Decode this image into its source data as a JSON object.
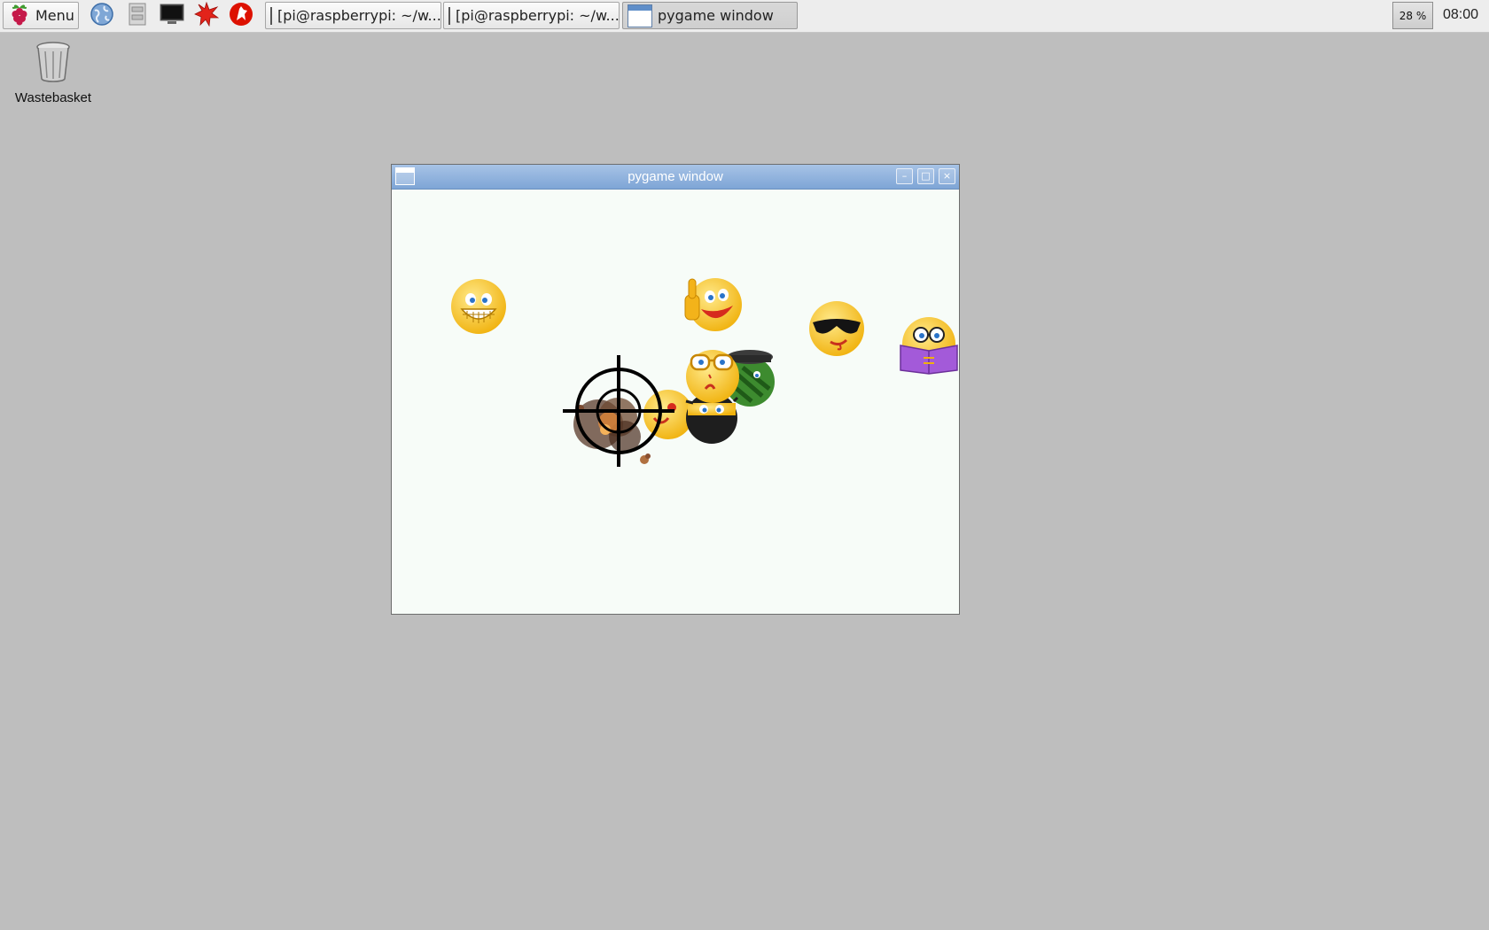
{
  "taskbar": {
    "menu_label": "Menu",
    "launchers": [
      "browser-icon",
      "file-manager-icon",
      "terminal-icon",
      "mathematica-icon",
      "wolfram-icon"
    ],
    "tasks": [
      {
        "label": "[pi@raspberrypi: ~/w...",
        "icon": "terminal-icon",
        "active": false
      },
      {
        "label": "[pi@raspberrypi: ~/w...",
        "icon": "terminal-icon",
        "active": false
      },
      {
        "label": "pygame window",
        "icon": "window-icon",
        "active": true
      }
    ],
    "cpu_usage": "28 %",
    "clock": "08:00"
  },
  "desktop": {
    "icons": [
      {
        "label": "Wastebasket",
        "icon": "trash-icon"
      }
    ]
  },
  "window": {
    "title": "pygame window",
    "controls": [
      "minimize",
      "maximize",
      "close"
    ],
    "sprites": [
      {
        "name": "grinning-smiley"
      },
      {
        "name": "thumbs-up-smiley"
      },
      {
        "name": "sunglasses-smiley"
      },
      {
        "name": "reading-smiley"
      },
      {
        "name": "glasses-smiley"
      },
      {
        "name": "soldier-smiley"
      },
      {
        "name": "ninja-smiley"
      },
      {
        "name": "crosshair"
      },
      {
        "name": "explosion"
      }
    ],
    "colors": {
      "canvas": "#f7fcf8",
      "smiley": "#f7c31b",
      "titlebar": "#8bb0dc"
    }
  }
}
